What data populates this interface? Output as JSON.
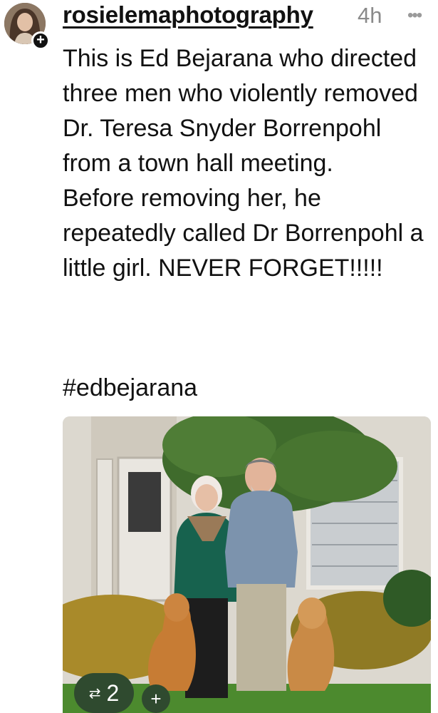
{
  "post": {
    "username": "rosielemaphotography",
    "timestamp": "4h",
    "more_icon": "ellipsis-icon",
    "follow_icon": "plus-icon",
    "paragraph1": "This is Ed Bejarana who directed three men who violently removed Dr. Teresa Snyder Borrenpohl from a town hall meeting.",
    "paragraph2": "Before removing her, he repeatedly called Dr Borrenpohl a little girl.  NEVER FORGET!!!!!",
    "hashtag": "#edbejarana"
  },
  "actions": {
    "repost_icon": "repost-icon",
    "repost_count": "2",
    "add_icon": "plus-icon",
    "add_label": "+",
    "accent": "#2f4a2f"
  }
}
